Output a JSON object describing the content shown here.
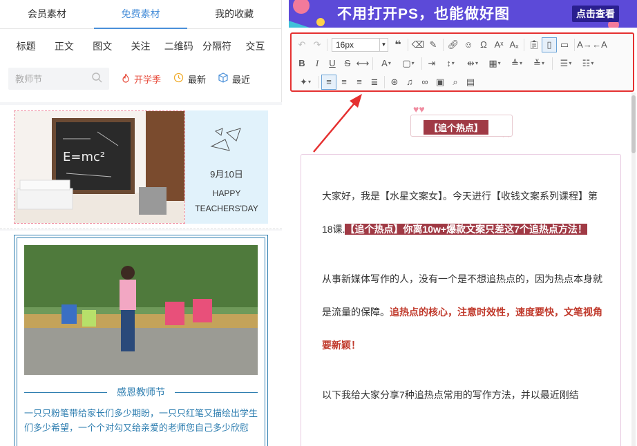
{
  "left_panel": {
    "tabs": [
      {
        "label": "会员素材",
        "active": false
      },
      {
        "label": "免费素材",
        "active": true
      },
      {
        "label": "我的收藏",
        "active": false
      }
    ],
    "categories": [
      "标题",
      "正文",
      "图文",
      "关注",
      "二维码",
      "分隔符",
      "交互"
    ],
    "search": {
      "placeholder": "教师节"
    },
    "filters": [
      {
        "label": "开学季",
        "icon": "flame-icon",
        "color": "#e74c3c"
      },
      {
        "label": "最新",
        "icon": "clock-icon"
      },
      {
        "label": "最近",
        "icon": "cube-icon"
      }
    ],
    "card1": {
      "date": "9月10日",
      "line1": "HAPPY",
      "line2": "TEACHERS'DAY"
    },
    "card2": {
      "title": "感恩教师节",
      "text": "一只只粉笔带给家长们多少期盼，一只只红笔又描绘出学生们多少希望，一个个对勾又给亲爱的老师您自己多少欣慰"
    }
  },
  "right_panel": {
    "banner": {
      "text": "不用打开PS，也能做好图",
      "cta": "点击查看"
    },
    "toolbar": {
      "font_size": "16px"
    },
    "article": {
      "hot_title": "【追个热点】",
      "p1_plain": "大家好，我是【水星文案女】。今天进行【收钱文案系列课程】第18课.",
      "p1_highlight": "【追个热点】你离10w+爆款文案只差这7个追热点方法！",
      "p2_plain": "从事新媒体写作的人，没有一个是不想追热点的，因为热点本身就是流量的保障。",
      "p2_bold": "追热点的核心，注意时效性，速度要快，文笔视角要新颖！",
      "p3_plain": "以下我给大家分享7种追热点常用的写作方法，并以最近刚结"
    }
  },
  "colors": {
    "accent_blue": "#4a90d9",
    "highlight_red": "#e53030",
    "title_bg": "#a03a45",
    "teal": "#2e7eb0"
  }
}
